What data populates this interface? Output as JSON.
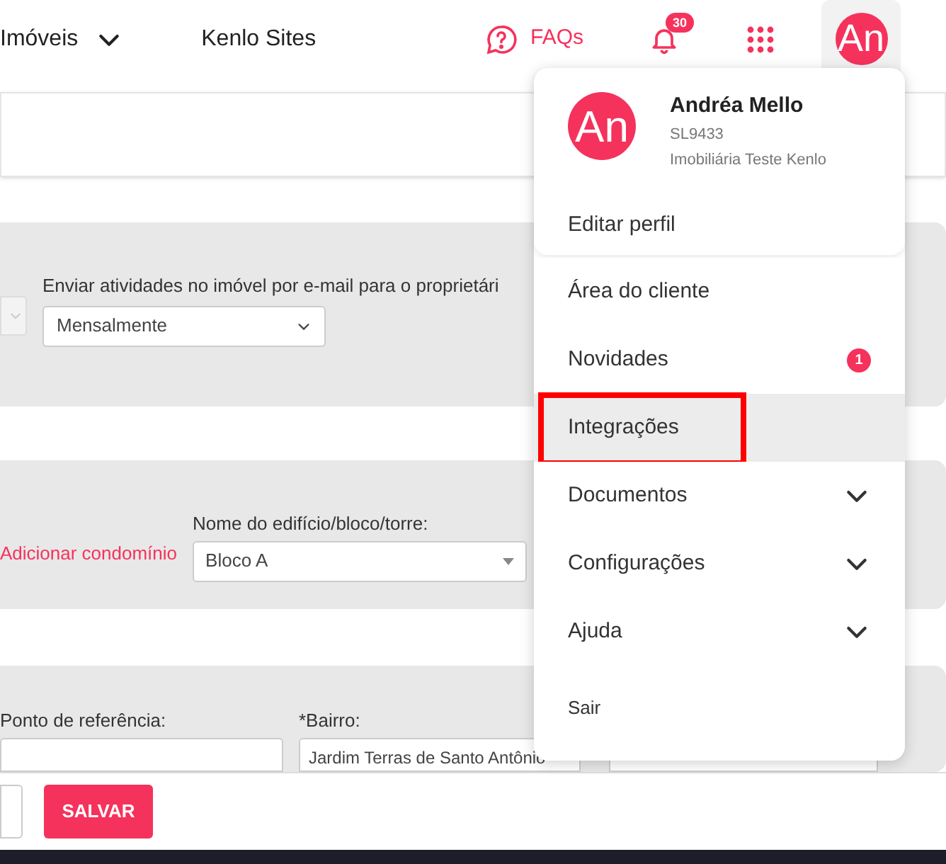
{
  "nav": {
    "items": [
      {
        "label": "Imóveis",
        "kind": "dropdown"
      },
      {
        "label": "Kenlo Sites",
        "kind": "link"
      }
    ],
    "faq": "FAQs",
    "notifications": "30",
    "avatar": "An"
  },
  "form": {
    "email_label": "Enviar atividades no imóvel por e-mail para o proprietári",
    "email_value": "Mensalmente",
    "add_condo": "Adicionar condomínio",
    "building_label": "Nome do edifício/bloco/torre:",
    "building_value": "Bloco A",
    "reference_label": "Ponto de referência:",
    "district_label": "*Bairro:",
    "district_value": "Jardim Terras de Santo Antônio"
  },
  "footer": {
    "save": "SALVAR"
  },
  "menu": {
    "avatar": "An",
    "name": "Andréa Mello",
    "code": "SL9433",
    "company": "Imobiliária Teste Kenlo",
    "edit": "Editar perfil",
    "items": [
      {
        "label": "Área do cliente",
        "kind": "link",
        "selected": false
      },
      {
        "label": "Novidades",
        "kind": "badge",
        "badge": "1",
        "selected": false
      },
      {
        "label": "Integrações",
        "kind": "link",
        "selected": true,
        "highlighted": true
      },
      {
        "label": "Documentos",
        "kind": "expand",
        "selected": false
      },
      {
        "label": "Configurações",
        "kind": "expand",
        "selected": false
      },
      {
        "label": "Ajuda",
        "kind": "expand",
        "selected": false
      },
      {
        "label": "Sair",
        "kind": "small",
        "selected": false
      }
    ]
  }
}
